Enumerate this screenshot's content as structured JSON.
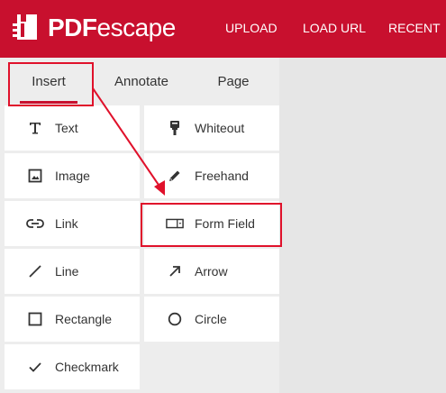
{
  "header": {
    "logo_text_bold": "PDF",
    "logo_text_light": "escape",
    "nav": [
      "UPLOAD",
      "LOAD URL",
      "RECENT"
    ]
  },
  "tabs": [
    "Insert",
    "Annotate",
    "Page"
  ],
  "active_tab": "Insert",
  "tools": [
    {
      "label": "Text",
      "icon": "text-icon"
    },
    {
      "label": "Whiteout",
      "icon": "whiteout-icon"
    },
    {
      "label": "Image",
      "icon": "image-icon"
    },
    {
      "label": "Freehand",
      "icon": "pencil-icon"
    },
    {
      "label": "Link",
      "icon": "link-icon"
    },
    {
      "label": "Form Field",
      "icon": "form-field-icon"
    },
    {
      "label": "Line",
      "icon": "line-icon"
    },
    {
      "label": "Arrow",
      "icon": "arrow-icon"
    },
    {
      "label": "Rectangle",
      "icon": "rectangle-icon"
    },
    {
      "label": "Circle",
      "icon": "circle-icon"
    },
    {
      "label": "Checkmark",
      "icon": "checkmark-icon"
    }
  ],
  "colors": {
    "brand_red": "#c8102e",
    "annotation_red": "#e0112b",
    "panel_bg": "#ededed",
    "canvas_bg": "#e6e6e6"
  }
}
